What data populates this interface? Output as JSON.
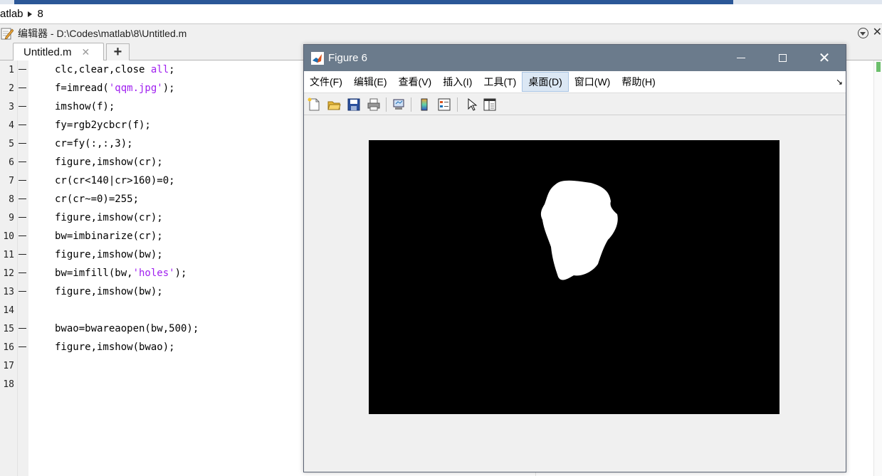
{
  "breadcrumb": {
    "part1": "atlab",
    "part2": "8"
  },
  "editor": {
    "title": "编辑器 - D:\\Codes\\matlab\\8\\Untitled.m",
    "tab_label": "Untitled.m",
    "tab_close": "✕",
    "tab_add": "+"
  },
  "code_lines": [
    {
      "n": "1",
      "code": "clc,clear,close all;"
    },
    {
      "n": "2",
      "code": "f=imread('qqm.jpg');"
    },
    {
      "n": "3",
      "code": "imshow(f);"
    },
    {
      "n": "4",
      "code": "fy=rgb2ycbcr(f);"
    },
    {
      "n": "5",
      "code": "cr=fy(:,:,3);"
    },
    {
      "n": "6",
      "code": "figure,imshow(cr);"
    },
    {
      "n": "7",
      "code": "cr(cr<140|cr>160)=0;"
    },
    {
      "n": "8",
      "code": "cr(cr~=0)=255;"
    },
    {
      "n": "9",
      "code": "figure,imshow(cr);"
    },
    {
      "n": "10",
      "code": "bw=imbinarize(cr);"
    },
    {
      "n": "11",
      "code": "figure,imshow(bw);"
    },
    {
      "n": "12",
      "code": "bw=imfill(bw,'holes');"
    },
    {
      "n": "13",
      "code": "figure,imshow(bw);"
    },
    {
      "n": "14",
      "code": ""
    },
    {
      "n": "15",
      "code": "bwao=bwareaopen(bw,500);"
    },
    {
      "n": "16",
      "code": "figure,imshow(bwao);"
    },
    {
      "n": "17",
      "code": ""
    },
    {
      "n": "18",
      "code": ""
    }
  ],
  "figure": {
    "title": "Figure 6",
    "menu": [
      {
        "label": "文件(F)",
        "active": false
      },
      {
        "label": "编辑(E)",
        "active": false
      },
      {
        "label": "查看(V)",
        "active": false
      },
      {
        "label": "插入(I)",
        "active": false
      },
      {
        "label": "工具(T)",
        "active": false
      },
      {
        "label": "桌面(D)",
        "active": true
      },
      {
        "label": "窗口(W)",
        "active": false
      },
      {
        "label": "帮助(H)",
        "active": false
      }
    ],
    "close_glyph": "✕",
    "dock_glyph": "↘"
  },
  "colors": {
    "string": "#a020f0",
    "keyword": "#a020f0",
    "figure_title_bar": "#6b7b8c",
    "menu_active": "#dbe7f4"
  },
  "icons": [
    "pencil-edit-icon",
    "matlab-logo-icon",
    "new-figure-icon",
    "open-file-icon",
    "save-icon",
    "print-icon",
    "link-plot-icon",
    "colorbar-icon",
    "legend-icon",
    "pointer-icon",
    "property-editor-icon"
  ]
}
